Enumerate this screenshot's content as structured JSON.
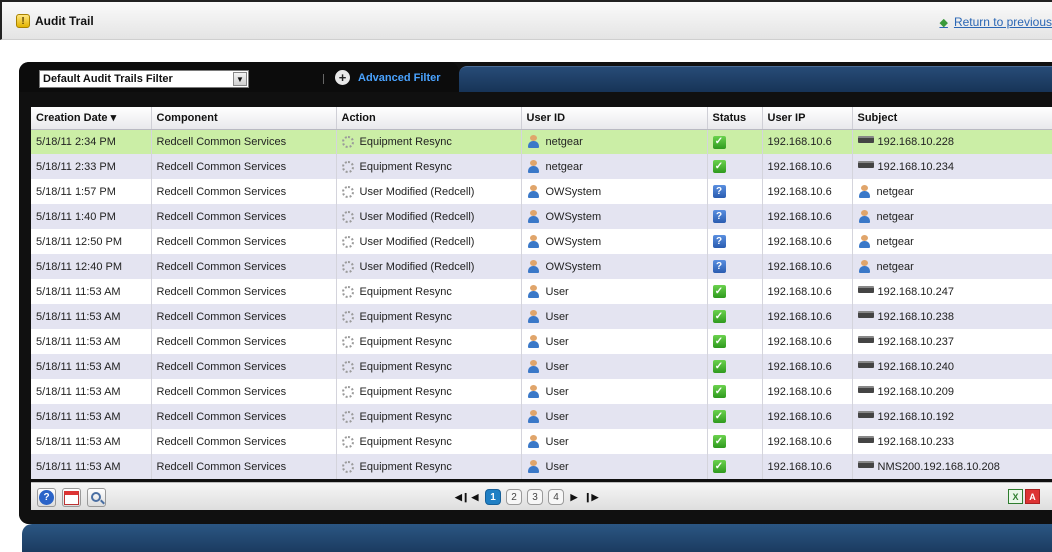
{
  "header": {
    "title": "Audit Trail",
    "return_link": "Return to previous"
  },
  "toolbar": {
    "filter_value": "Default Audit Trails Filter",
    "advanced_filter_label": "Advanced Filter"
  },
  "table": {
    "columns": [
      "Creation Date ▾",
      "Component",
      "Action",
      "User ID",
      "Status",
      "User IP",
      "Subject"
    ],
    "rows": [
      {
        "date": "5/18/11 2:34 PM",
        "component": "Redcell Common Services",
        "action": "Equipment Resync",
        "user": "netgear",
        "status": "ok",
        "ip": "192.168.10.6",
        "subject": "192.168.10.228",
        "subject_type": "device"
      },
      {
        "date": "5/18/11 2:33 PM",
        "component": "Redcell Common Services",
        "action": "Equipment Resync",
        "user": "netgear",
        "status": "ok",
        "ip": "192.168.10.6",
        "subject": "192.168.10.234",
        "subject_type": "device"
      },
      {
        "date": "5/18/11 1:57 PM",
        "component": "Redcell Common Services",
        "action": "User Modified (Redcell)",
        "user": "OWSystem",
        "status": "unknown",
        "ip": "192.168.10.6",
        "subject": "netgear",
        "subject_type": "user"
      },
      {
        "date": "5/18/11 1:40 PM",
        "component": "Redcell Common Services",
        "action": "User Modified (Redcell)",
        "user": "OWSystem",
        "status": "unknown",
        "ip": "192.168.10.6",
        "subject": "netgear",
        "subject_type": "user"
      },
      {
        "date": "5/18/11 12:50 PM",
        "component": "Redcell Common Services",
        "action": "User Modified (Redcell)",
        "user": "OWSystem",
        "status": "unknown",
        "ip": "192.168.10.6",
        "subject": "netgear",
        "subject_type": "user"
      },
      {
        "date": "5/18/11 12:40 PM",
        "component": "Redcell Common Services",
        "action": "User Modified (Redcell)",
        "user": "OWSystem",
        "status": "unknown",
        "ip": "192.168.10.6",
        "subject": "netgear",
        "subject_type": "user"
      },
      {
        "date": "5/18/11 11:53 AM",
        "component": "Redcell Common Services",
        "action": "Equipment Resync",
        "user": "User",
        "status": "ok",
        "ip": "192.168.10.6",
        "subject": "192.168.10.247",
        "subject_type": "device"
      },
      {
        "date": "5/18/11 11:53 AM",
        "component": "Redcell Common Services",
        "action": "Equipment Resync",
        "user": "User",
        "status": "ok",
        "ip": "192.168.10.6",
        "subject": "192.168.10.238",
        "subject_type": "device"
      },
      {
        "date": "5/18/11 11:53 AM",
        "component": "Redcell Common Services",
        "action": "Equipment Resync",
        "user": "User",
        "status": "ok",
        "ip": "192.168.10.6",
        "subject": "192.168.10.237",
        "subject_type": "device"
      },
      {
        "date": "5/18/11 11:53 AM",
        "component": "Redcell Common Services",
        "action": "Equipment Resync",
        "user": "User",
        "status": "ok",
        "ip": "192.168.10.6",
        "subject": "192.168.10.240",
        "subject_type": "device"
      },
      {
        "date": "5/18/11 11:53 AM",
        "component": "Redcell Common Services",
        "action": "Equipment Resync",
        "user": "User",
        "status": "ok",
        "ip": "192.168.10.6",
        "subject": "192.168.10.209",
        "subject_type": "device"
      },
      {
        "date": "5/18/11 11:53 AM",
        "component": "Redcell Common Services",
        "action": "Equipment Resync",
        "user": "User",
        "status": "ok",
        "ip": "192.168.10.6",
        "subject": "192.168.10.192",
        "subject_type": "device"
      },
      {
        "date": "5/18/11 11:53 AM",
        "component": "Redcell Common Services",
        "action": "Equipment Resync",
        "user": "User",
        "status": "ok",
        "ip": "192.168.10.6",
        "subject": "192.168.10.233",
        "subject_type": "device"
      },
      {
        "date": "5/18/11 11:53 AM",
        "component": "Redcell Common Services",
        "action": "Equipment Resync",
        "user": "User",
        "status": "ok",
        "ip": "192.168.10.6",
        "subject": "NMS200.192.168.10.208",
        "subject_type": "device"
      }
    ]
  },
  "pager": {
    "pages": [
      "1",
      "2",
      "3",
      "4"
    ],
    "active_page": "1"
  },
  "colors": {
    "selected_row": "#cbeea6",
    "striped_row": "#e4e4f1",
    "tab_blue": "#1f3f66",
    "link_blue": "#2b67b5"
  }
}
